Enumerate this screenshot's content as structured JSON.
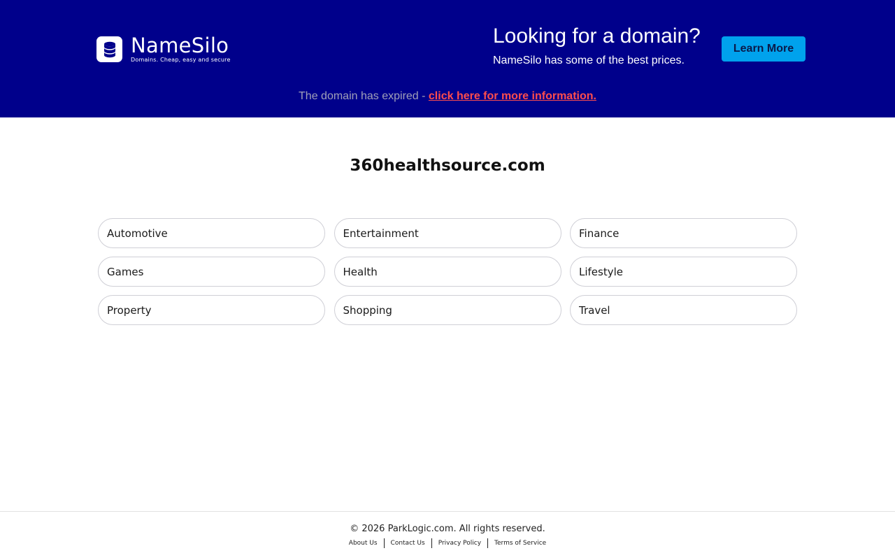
{
  "banner": {
    "logo": {
      "name": "NameSilo",
      "tagline": "Domains. Cheap, easy and secure",
      "icon": "database-icon"
    },
    "headline": "Looking for a domain?",
    "subheadline": "NameSilo has some of the best prices.",
    "learn_more_label": "Learn More",
    "expired_text": "The domain has expired - ",
    "expired_link": "click here for more information.",
    "colors": {
      "background": "#00008b",
      "button": "#00a2ed",
      "link": "#ff4d4d"
    }
  },
  "main": {
    "domain": "360healthsource.com",
    "categories": [
      "Automotive",
      "Entertainment",
      "Finance",
      "Games",
      "Health",
      "Lifestyle",
      "Property",
      "Shopping",
      "Travel"
    ]
  },
  "footer": {
    "copyright": "© 2026 ParkLogic.com. All rights reserved.",
    "links": [
      "About Us",
      "Contact Us",
      "Privacy Policy",
      "Terms of Service"
    ]
  }
}
